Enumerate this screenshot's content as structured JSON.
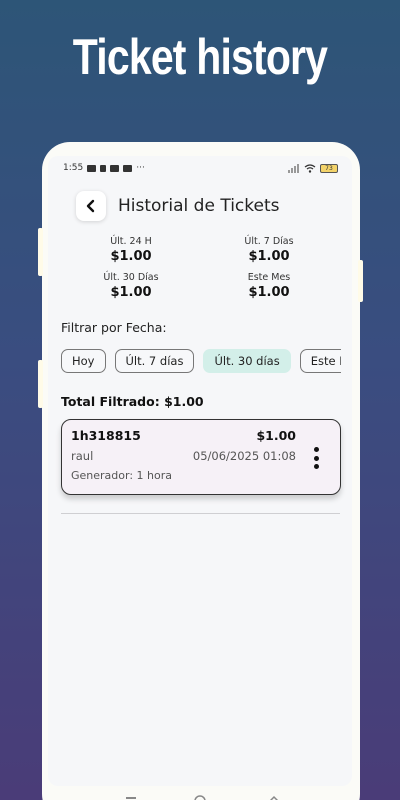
{
  "promo": {
    "title": "Ticket history"
  },
  "status_bar": {
    "time": "1:55",
    "dots": "···",
    "battery": "73"
  },
  "header": {
    "title": "Historial de Tickets",
    "back_icon": "chevron-left-icon"
  },
  "stats": [
    {
      "label": "Últ. 24 H",
      "value": "$1.00"
    },
    {
      "label": "Últ. 7 Días",
      "value": "$1.00"
    },
    {
      "label": "Últ. 30 Días",
      "value": "$1.00"
    },
    {
      "label": "Este Mes",
      "value": "$1.00"
    }
  ],
  "filter": {
    "label": "Filtrar por Fecha:",
    "chips": [
      "Hoy",
      "Últ. 7 días",
      "Últ. 30 días",
      "Este Mes"
    ],
    "selected": "Últ. 30 días"
  },
  "total": {
    "label": "Total Filtrado: $1.00"
  },
  "tickets": [
    {
      "id": "1h318815",
      "amount": "$1.00",
      "user": "raul",
      "date": "05/06/2025 01:08",
      "generator": "Generador: 1 hora"
    }
  ],
  "colors": {
    "accent_chip": "#d3efe9",
    "ticket_bg": "#f6f1f7",
    "background_top": "#2d5577",
    "background_bottom": "#4a3c78"
  }
}
